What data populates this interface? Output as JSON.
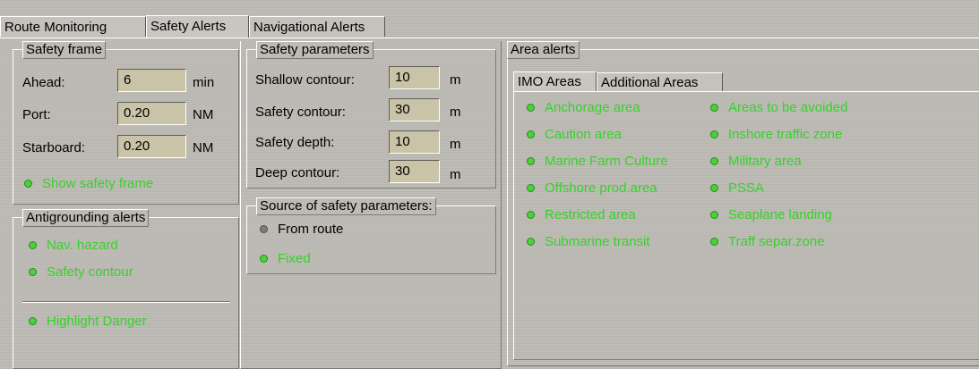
{
  "tabs": [
    "Route Monitoring",
    "Safety Alerts",
    "Navigational Alerts"
  ],
  "safety_frame": {
    "title": "Safety frame",
    "ahead": {
      "label": "Ahead:",
      "value": "6",
      "unit": "min"
    },
    "port": {
      "label": "Port:",
      "value": "0.20",
      "unit": "NM"
    },
    "starboard": {
      "label": "Starboard:",
      "value": "0.20",
      "unit": "NM"
    },
    "show_frame": "Show safety frame"
  },
  "antigrounding": {
    "title": "Antigrounding alerts",
    "nav_hazard": "Nav. hazard",
    "safety_contour": "Safety contour",
    "highlight": "Highlight Danger"
  },
  "safety_params": {
    "title": "Safety parameters",
    "shallow": {
      "label": "Shallow contour:",
      "value": "10",
      "unit": "m"
    },
    "safety_contour": {
      "label": "Safety contour:",
      "value": "30",
      "unit": "m"
    },
    "safety_depth": {
      "label": "Safety depth:",
      "value": "10",
      "unit": "m"
    },
    "deep": {
      "label": "Deep contour:",
      "value": "30",
      "unit": "m"
    }
  },
  "source": {
    "title": "Source of safety parameters:",
    "from_route": "From route",
    "fixed": "Fixed"
  },
  "area_alerts": {
    "title": "Area alerts",
    "subtabs": [
      "IMO Areas",
      "Additional Areas"
    ],
    "col1": [
      "Anchorage area",
      "Caution area",
      "Marine Farm Culture",
      "Offshore prod.area",
      "Restricted area",
      "Submarine transit"
    ],
    "col2": [
      "Areas to be avoided",
      "Inshore traffic zone",
      "Military area",
      "PSSA",
      "Seaplane landing",
      "Traff separ.zone"
    ]
  }
}
